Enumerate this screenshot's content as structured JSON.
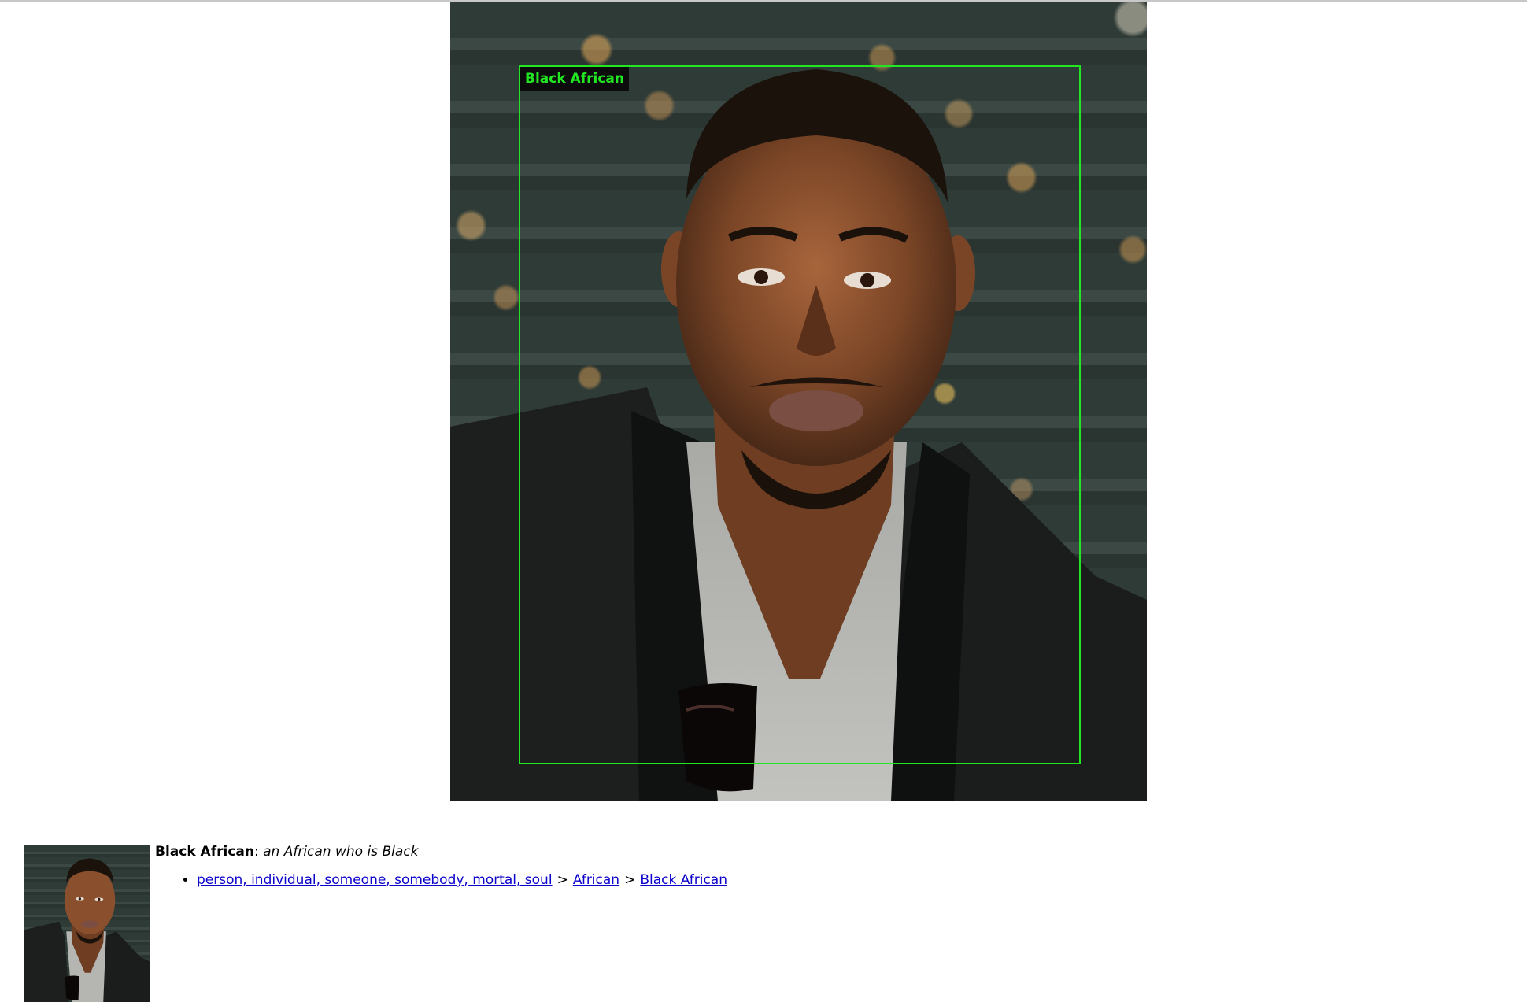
{
  "annotation": {
    "label": "Black African",
    "box_color": "#22e622"
  },
  "entry": {
    "title": "Black African",
    "separator": ": ",
    "definition": "an African who is Black",
    "hierarchy": [
      {
        "label": "person, individual, someone, somebody, mortal, soul"
      },
      {
        "label": "African"
      },
      {
        "label": "Black African"
      }
    ],
    "hierarchy_separator": ">"
  },
  "colors": {
    "link": "#0b00cc",
    "label_bg": "#0c0c0c"
  }
}
